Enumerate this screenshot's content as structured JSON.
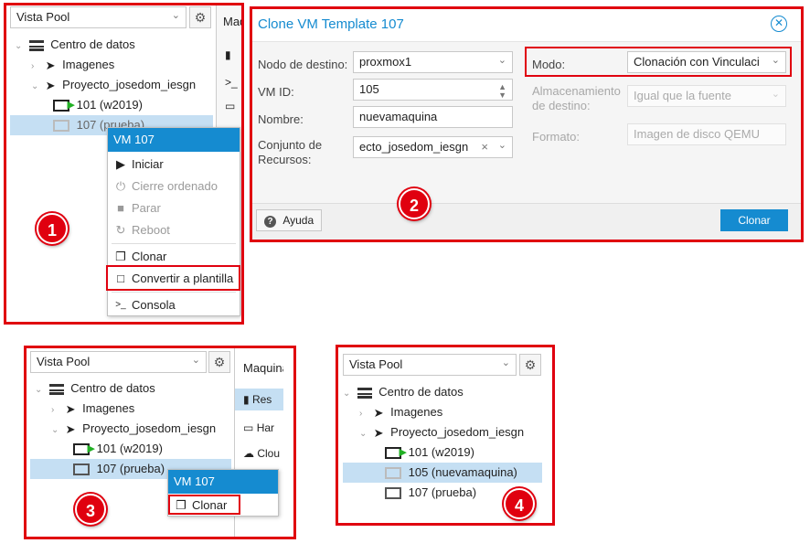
{
  "panel1": {
    "view_select": "Vista Pool",
    "tree": {
      "root": "Centro de datos",
      "images": "Imagenes",
      "project": "Proyecto_josedom_iesgn",
      "vm101": "101 (w2019)",
      "vm107": "107 (prueba)"
    },
    "side_col_title": "Maqu",
    "context_menu": {
      "title": "VM 107",
      "items": [
        "Iniciar",
        "Cierre ordenado",
        "Parar",
        "Reboot",
        "Clonar",
        "Convertir a plantilla",
        "Consola"
      ]
    },
    "badge": "1"
  },
  "dialog": {
    "title": "Clone VM Template 107",
    "labels": {
      "target_node": "Nodo de destino:",
      "vm_id": "VM ID:",
      "name": "Nombre:",
      "pool": "Conjunto de Recursos:",
      "mode": "Modo:",
      "target_storage": "Almacenamiento de destino:",
      "format": "Formato:"
    },
    "values": {
      "target_node": "proxmox1",
      "vm_id": "105",
      "name": "nuevamaquina",
      "pool": "ecto_josedom_iesgn",
      "mode": "Clonación con Vinculaci",
      "target_storage": "Igual que la fuente",
      "format": "Imagen de disco QEMU"
    },
    "help_button": "Ayuda",
    "clone_button": "Clonar",
    "badge": "2"
  },
  "panel3": {
    "view_select": "Vista Pool",
    "tree": {
      "root": "Centro de datos",
      "images": "Imagenes",
      "project": "Proyecto_josedom_iesgn",
      "vm101": "101 (w2019)",
      "vm107": "107 (prueba)"
    },
    "side_col": [
      "Maquina",
      "Res",
      "Har",
      "Clou"
    ],
    "context_menu": {
      "title": "VM 107",
      "items": [
        "Clonar"
      ]
    },
    "badge": "3"
  },
  "panel4": {
    "view_select": "Vista Pool",
    "tree": {
      "root": "Centro de datos",
      "images": "Imagenes",
      "project": "Proyecto_josedom_iesgn",
      "vm101": "101 (w2019)",
      "vm105": "105 (nuevamaquina)",
      "vm107": "107 (prueba)"
    },
    "badge": "4"
  },
  "colors": {
    "highlight": "#e0000f",
    "accent": "#158bd0",
    "selection": "#c5dff3",
    "running": "#21b024"
  }
}
